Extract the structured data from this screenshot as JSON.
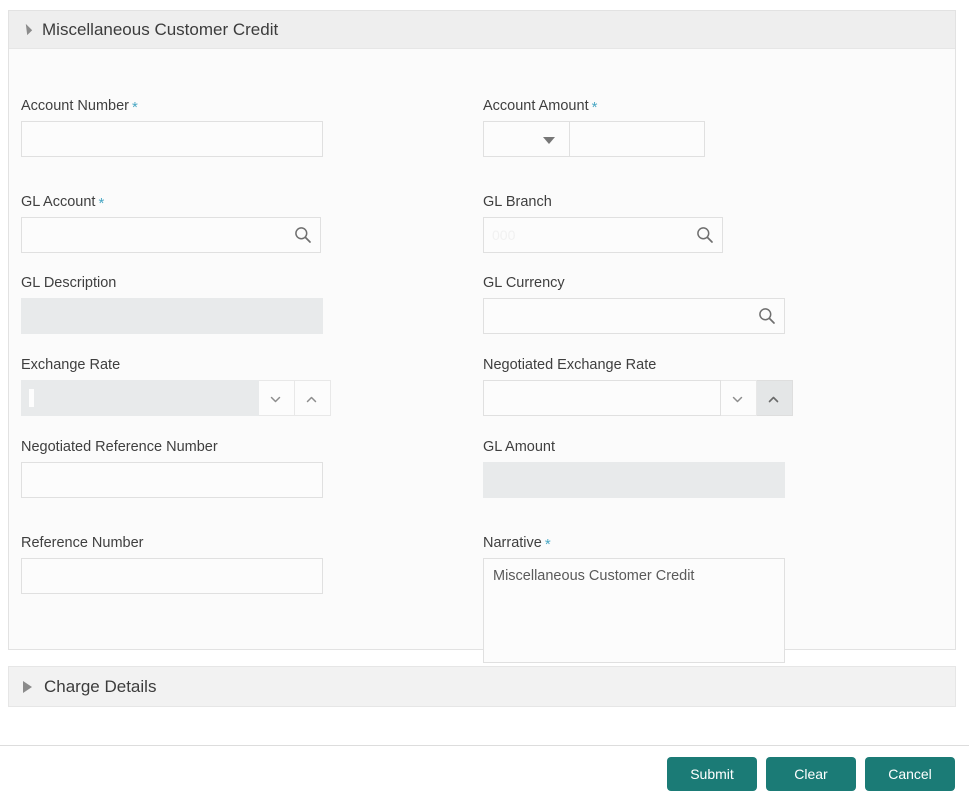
{
  "panel": {
    "title": "Miscellaneous Customer Credit",
    "expand_icon": "triangle-expanded-icon",
    "collapse_state": "expanded"
  },
  "fields": {
    "account_number": {
      "label": "Account Number",
      "required": "*",
      "value": "",
      "placeholder": ""
    },
    "account_amount": {
      "label": "Account Amount",
      "required": "*",
      "currency_value": "",
      "currency_icon": "caret-down-icon",
      "amount_value": "",
      "amount_placeholder": ""
    },
    "gl_account": {
      "label": "GL Account",
      "required": "*",
      "value": "",
      "placeholder": "",
      "icon": "search-icon"
    },
    "gl_branch": {
      "label": "GL Branch",
      "required": "",
      "value": "000",
      "placeholder": "000",
      "icon": "search-icon"
    },
    "gl_description": {
      "label": "GL Description",
      "required": "",
      "value": "",
      "disabled": true
    },
    "gl_currency": {
      "label": "GL Currency",
      "required": "",
      "value": "",
      "placeholder": "",
      "icon": "search-icon"
    },
    "exchange_rate": {
      "label": "Exchange Rate",
      "required": "",
      "value": "",
      "disabled": true,
      "down_icon": "chevron-down-icon",
      "up_icon": "chevron-up-icon"
    },
    "negotiated_exchange_rate": {
      "label": "Negotiated Exchange Rate",
      "required": "",
      "value": "",
      "down_icon": "chevron-down-icon",
      "up_icon": "chevron-up-icon"
    },
    "negotiated_reference_number": {
      "label": "Negotiated Reference Number",
      "required": "",
      "value": "",
      "placeholder": ""
    },
    "gl_amount": {
      "label": "GL Amount",
      "required": "",
      "value": "",
      "disabled": true
    },
    "reference_number": {
      "label": "Reference Number",
      "required": "",
      "value": "",
      "placeholder": ""
    },
    "narrative": {
      "label": "Narrative",
      "required": "*",
      "value": "Miscellaneous Customer Credit",
      "placeholder": ""
    }
  },
  "charge_details": {
    "title": "Charge Details",
    "expand_icon": "triangle-collapsed-icon",
    "collapse_state": "collapsed"
  },
  "footer": {
    "submit_label": "Submit",
    "clear_label": "Clear",
    "cancel_label": "Cancel"
  },
  "colors": {
    "button_teal": "#1b7b76",
    "required_asterisk": "#49a7c4",
    "panel_header": "#eeeeee",
    "disabled_field": "#e8eaeb"
  }
}
